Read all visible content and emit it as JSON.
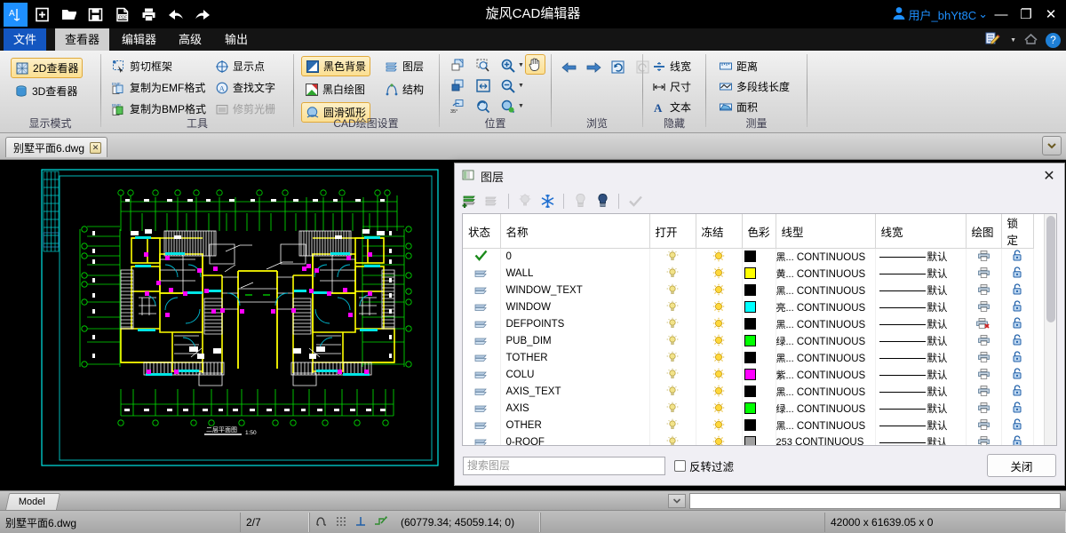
{
  "app": {
    "title": "旋风CAD编辑器",
    "user": "用户_bhYt8C",
    "minimize": "—",
    "maximize": "❐",
    "close": "✕",
    "caret": "⌄"
  },
  "quick_access": [
    {
      "name": "app-logo-icon",
      "label": "A"
    },
    {
      "name": "new-file-icon",
      "label": "new"
    },
    {
      "name": "open-file-icon",
      "label": "open"
    },
    {
      "name": "save-file-icon",
      "label": "save"
    },
    {
      "name": "export-pdf-icon",
      "label": "PDF"
    },
    {
      "name": "print-icon",
      "label": "print"
    },
    {
      "name": "undo-icon",
      "label": "undo"
    },
    {
      "name": "redo-icon",
      "label": "redo"
    }
  ],
  "menu": {
    "file_tab": "文件",
    "tabs": [
      {
        "label": "查看器",
        "selected": true
      },
      {
        "label": "编辑器",
        "selected": false
      },
      {
        "label": "高级",
        "selected": false
      },
      {
        "label": "输出",
        "selected": false
      }
    ],
    "right_icons": [
      {
        "name": "annotate-icon"
      },
      {
        "name": "home-icon"
      },
      {
        "name": "help-icon",
        "label": "?"
      }
    ]
  },
  "ribbon": {
    "groups": [
      {
        "name": "display-mode",
        "label": "显示模式",
        "items": [
          {
            "label": "2D查看器",
            "checked": true,
            "icon": "cube-2d-icon"
          },
          {
            "label": "3D查看器",
            "checked": false,
            "icon": "cylinder-3d-icon"
          }
        ]
      },
      {
        "name": "tools",
        "label": "工具",
        "items": [
          {
            "label": "剪切框架",
            "icon": "crop-frame-icon",
            "disabled": false
          },
          {
            "label": "复制为EMF格式",
            "icon": "copy-emf-icon",
            "disabled": false
          },
          {
            "label": "复制为BMP格式",
            "icon": "copy-bmp-icon",
            "disabled": false
          },
          {
            "label": "显示点",
            "icon": "show-points-icon",
            "disabled": false
          },
          {
            "label": "查找文字",
            "icon": "find-text-icon",
            "disabled": false
          },
          {
            "label": "修剪光栅",
            "icon": "trim-raster-icon",
            "disabled": true
          }
        ]
      },
      {
        "name": "cad-draw-settings",
        "label": "CAD绘图设置",
        "items": [
          {
            "label": "黑色背景",
            "icon": "black-background-icon",
            "checked": true
          },
          {
            "label": "黑白绘图",
            "icon": "monochrome-icon",
            "checked": false
          },
          {
            "label": "圆滑弧形",
            "icon": "smooth-arc-icon",
            "checked": true
          },
          {
            "label": "图层",
            "icon": "layers-icon",
            "checked": false
          },
          {
            "label": "结构",
            "icon": "structure-icon",
            "checked": false
          }
        ]
      },
      {
        "name": "position",
        "label": "位置",
        "icons": [
          {
            "name": "zoom-window-icon",
            "checked": false,
            "caret": false
          },
          {
            "name": "zoom-select-icon",
            "checked": false,
            "caret": false
          },
          {
            "name": "zoom-in-icon",
            "checked": false,
            "caret": true
          },
          {
            "name": "pan-hand-icon",
            "checked": true,
            "caret": false
          },
          {
            "name": "zoom-previous-icon",
            "checked": false,
            "caret": false
          },
          {
            "name": "zoom-extents-icon",
            "checked": false,
            "caret": false
          },
          {
            "name": "zoom-out-icon",
            "checked": false,
            "caret": true
          },
          {
            "name": "rotate-35-icon",
            "checked": false,
            "caret": false,
            "label": "35°"
          },
          {
            "name": "zoom-realtime-icon",
            "checked": false,
            "caret": false
          },
          {
            "name": "zoom-dynamic-icon",
            "checked": false,
            "caret": true
          }
        ]
      },
      {
        "name": "browse",
        "label": "浏览",
        "icons": [
          {
            "name": "previous-arrow-icon",
            "disabled": false
          },
          {
            "name": "next-arrow-icon",
            "disabled": false
          },
          {
            "name": "refresh-view-icon",
            "disabled": false
          },
          {
            "name": "restore-view-icon",
            "disabled": true
          }
        ]
      },
      {
        "name": "hide",
        "label": "隐藏",
        "items": [
          {
            "label": "线宽",
            "icon": "lineweight-icon"
          },
          {
            "label": "尺寸",
            "icon": "dimension-icon"
          },
          {
            "label": "文本",
            "icon": "text-a-icon"
          }
        ]
      },
      {
        "name": "measure",
        "label": "测量",
        "items": [
          {
            "label": "距离",
            "icon": "distance-icon"
          },
          {
            "label": "多段线长度",
            "icon": "polyline-length-icon"
          },
          {
            "label": "面积",
            "icon": "area-icon"
          }
        ]
      }
    ]
  },
  "doc_tabs": {
    "tabs": [
      {
        "label": "别墅平面6.dwg",
        "close": "✕"
      }
    ],
    "dropdown": "⌄"
  },
  "drawing": {
    "title_text": "二层平面图",
    "scale_text": "1:50"
  },
  "layer_dialog": {
    "title": "图层",
    "close_icon": "✕",
    "toolbar": [
      {
        "name": "new-layer-icon",
        "disabled": false
      },
      {
        "name": "delete-layer-icon",
        "disabled": true
      },
      {
        "name": "lamp-off-icon",
        "disabled": true
      },
      {
        "name": "freeze-snowflake-icon",
        "disabled": false
      },
      {
        "name": "bulb-off-icon",
        "disabled": true
      },
      {
        "name": "bulb-on-icon",
        "disabled": false
      },
      {
        "name": "apply-check-icon",
        "disabled": true
      }
    ],
    "columns": [
      "状态",
      "名称",
      "打开",
      "冻结",
      "色彩",
      "线型",
      "线宽",
      "绘图",
      "锁定"
    ],
    "rows": [
      {
        "status": "current",
        "name": "0",
        "on": "bulb-dim",
        "freeze": "sun",
        "color_hex": "#000000",
        "color_label": "黑...",
        "linetype": "CONTINUOUS",
        "lineweight": "默认",
        "plot": "plot-on",
        "lock": "unlocked"
      },
      {
        "status": "layer",
        "name": "WALL",
        "on": "bulb-dim",
        "freeze": "sun",
        "color_hex": "#ffff00",
        "color_label": "黄...",
        "linetype": "CONTINUOUS",
        "lineweight": "默认",
        "plot": "plot-on",
        "lock": "unlocked"
      },
      {
        "status": "layer",
        "name": "WINDOW_TEXT",
        "on": "bulb-dim",
        "freeze": "sun",
        "color_hex": "#000000",
        "color_label": "黑...",
        "linetype": "CONTINUOUS",
        "lineweight": "默认",
        "plot": "plot-on",
        "lock": "unlocked"
      },
      {
        "status": "layer",
        "name": "WINDOW",
        "on": "bulb-dim",
        "freeze": "sun",
        "color_hex": "#00ffff",
        "color_label": "亮...",
        "linetype": "CONTINUOUS",
        "lineweight": "默认",
        "plot": "plot-on",
        "lock": "unlocked"
      },
      {
        "status": "layer",
        "name": "DEFPOINTS",
        "on": "bulb-dim",
        "freeze": "sun",
        "color_hex": "#000000",
        "color_label": "黑...",
        "linetype": "CONTINUOUS",
        "lineweight": "默认",
        "plot": "plot-off",
        "lock": "unlocked"
      },
      {
        "status": "layer",
        "name": "PUB_DIM",
        "on": "bulb-dim",
        "freeze": "sun",
        "color_hex": "#00ff00",
        "color_label": "绿...",
        "linetype": "CONTINUOUS",
        "lineweight": "默认",
        "plot": "plot-on",
        "lock": "unlocked"
      },
      {
        "status": "layer",
        "name": "TOTHER",
        "on": "bulb-dim",
        "freeze": "sun",
        "color_hex": "#000000",
        "color_label": "黑...",
        "linetype": "CONTINUOUS",
        "lineweight": "默认",
        "plot": "plot-on",
        "lock": "unlocked"
      },
      {
        "status": "layer",
        "name": "COLU",
        "on": "bulb-dim",
        "freeze": "sun",
        "color_hex": "#ff00ff",
        "color_label": "紫...",
        "linetype": "CONTINUOUS",
        "lineweight": "默认",
        "plot": "plot-on",
        "lock": "unlocked"
      },
      {
        "status": "layer",
        "name": "AXIS_TEXT",
        "on": "bulb-dim",
        "freeze": "sun",
        "color_hex": "#000000",
        "color_label": "黑...",
        "linetype": "CONTINUOUS",
        "lineweight": "默认",
        "plot": "plot-on",
        "lock": "unlocked"
      },
      {
        "status": "layer",
        "name": "AXIS",
        "on": "bulb-dim",
        "freeze": "sun",
        "color_hex": "#00ff00",
        "color_label": "绿...",
        "linetype": "CONTINUOUS",
        "lineweight": "默认",
        "plot": "plot-on",
        "lock": "unlocked"
      },
      {
        "status": "layer",
        "name": "OTHER",
        "on": "bulb-dim",
        "freeze": "sun",
        "color_hex": "#000000",
        "color_label": "黑...",
        "linetype": "CONTINUOUS",
        "lineweight": "默认",
        "plot": "plot-on",
        "lock": "unlocked"
      },
      {
        "status": "layer",
        "name": "0-ROOF",
        "on": "bulb-dim",
        "freeze": "sun",
        "color_hex": "#a0a0a0",
        "color_label": "253",
        "linetype": "CONTINUOUS",
        "lineweight": "默认",
        "plot": "plot-on",
        "lock": "unlocked"
      }
    ],
    "search_placeholder": "搜索图层",
    "invert_filter_label": "反转过滤",
    "close_button": "关闭"
  },
  "bottom": {
    "model_tab": "Model",
    "file_name": "别墅平面6.dwg",
    "page_indicator": "2/7",
    "coordinates": "(60779.34; 45059.14; 0)",
    "extents": "42000 x 61639.05 x 0",
    "snap_icons": [
      {
        "name": "osnap-icon"
      },
      {
        "name": "grid-snap-icon"
      },
      {
        "name": "ortho-icon"
      },
      {
        "name": "polar-icon"
      }
    ]
  }
}
